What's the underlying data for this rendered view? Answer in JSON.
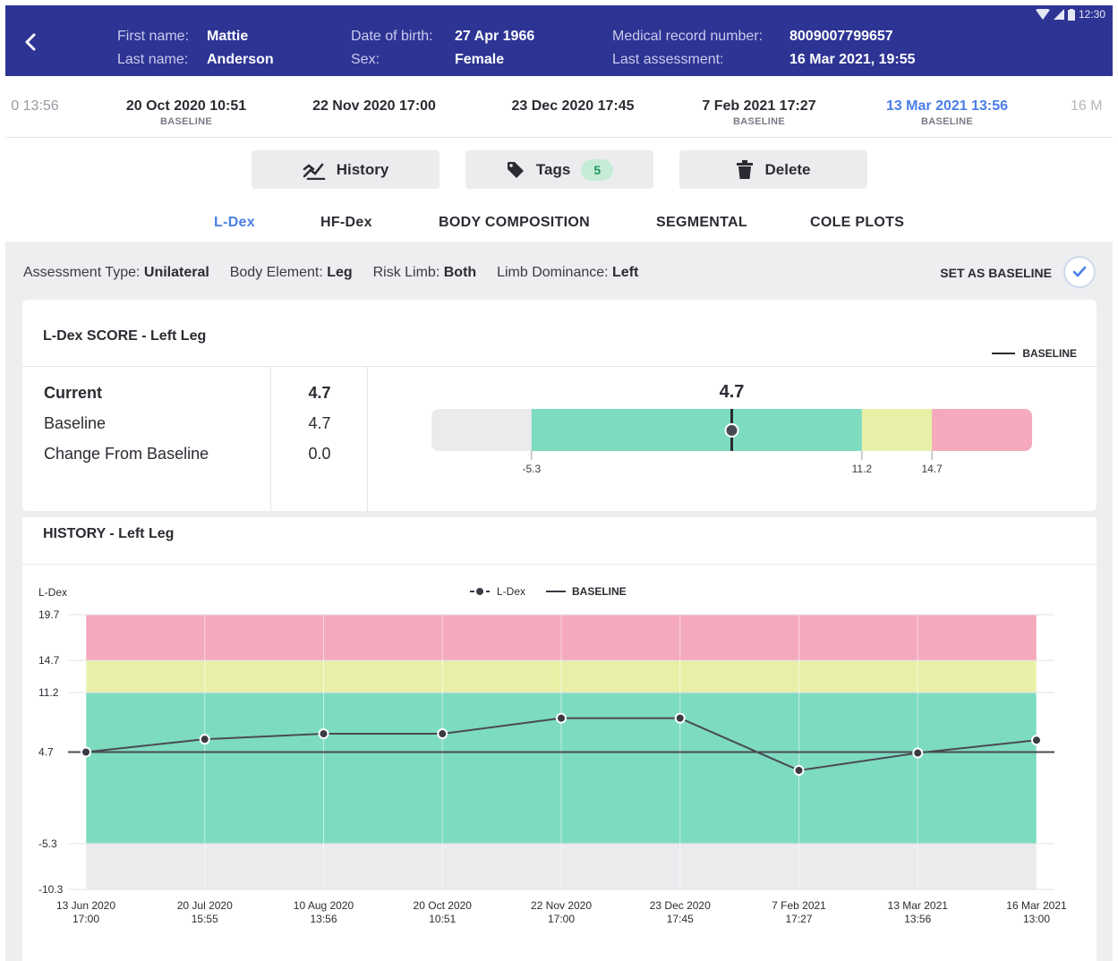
{
  "status_bar": {
    "time": "12:30"
  },
  "patient": {
    "first_name_label": "First name:",
    "first_name": "Mattie",
    "last_name_label": "Last name:",
    "last_name": "Anderson",
    "dob_label": "Date of birth:",
    "dob": "27 Apr 1966",
    "sex_label": "Sex:",
    "sex": "Female",
    "mrn_label": "Medical record number:",
    "mrn": "8009007799657",
    "last_assessment_label": "Last assessment:",
    "last_assessment": "16 Mar 2021, 19:55"
  },
  "timeline": {
    "items": [
      {
        "date": "0 13:56",
        "sub": ""
      },
      {
        "date": "20 Oct 2020 10:51",
        "sub": "BASELINE"
      },
      {
        "date": "22 Nov 2020 17:00",
        "sub": ""
      },
      {
        "date": "23 Dec 2020 17:45",
        "sub": ""
      },
      {
        "date": "7 Feb 2021 17:27",
        "sub": "BASELINE"
      },
      {
        "date": "13 Mar 2021 13:56",
        "sub": "BASELINE"
      },
      {
        "date": "16 M",
        "sub": ""
      }
    ]
  },
  "actions": {
    "history_label": "History",
    "tags_label": "Tags",
    "tags_count": "5",
    "delete_label": "Delete"
  },
  "tabs": {
    "ldex": "L-Dex",
    "hfdex": "HF-Dex",
    "body_comp": "BODY COMPOSITION",
    "segmental": "SEGMENTAL",
    "cole": "COLE PLOTS"
  },
  "assessment": {
    "type_label": "Assessment Type:",
    "type": "Unilateral",
    "element_label": "Body Element:",
    "element": "Leg",
    "risk_label": "Risk Limb:",
    "risk": "Both",
    "dominance_label": "Limb Dominance:",
    "dominance": "Left",
    "set_baseline": "SET AS BASELINE"
  },
  "score": {
    "title": "L-Dex SCORE - Left Leg",
    "legend_baseline": "BASELINE",
    "current_label": "Current",
    "current_value": "4.7",
    "baseline_label": "Baseline",
    "baseline_value": "4.7",
    "change_label": "Change From Baseline",
    "change_value": "0.0",
    "gauge_value_text": "4.7",
    "gauge_value": 4.7,
    "gauge_min": -10.3,
    "gauge_max": 19.7,
    "gauge_ticks": [
      "-5.3",
      "11.2",
      "14.7"
    ]
  },
  "history": {
    "title": "HISTORY - Left Leg"
  },
  "colors": {
    "header": "#2d3494",
    "accent": "#4a7ee8",
    "green_zone": "#7ddbc0",
    "yellow_zone": "#e8f0a8",
    "red_zone": "#f5a9bc",
    "gray_zone": "#ebebee"
  },
  "chart_data": {
    "type": "line",
    "ylabel": "L-Dex",
    "legend": [
      "L-Dex",
      "BASELINE"
    ],
    "legend_position": "top-center",
    "ylim": [
      -10.3,
      19.7
    ],
    "yticks": [
      "19.7",
      "14.7",
      "11.2",
      "4.7",
      "-5.3",
      "-10.3"
    ],
    "ytick_values": [
      19.7,
      14.7,
      11.2,
      4.7,
      -5.3,
      -10.3
    ],
    "categories": [
      [
        "13 Jun 2020",
        "17:00"
      ],
      [
        "20 Jul 2020",
        "15:55"
      ],
      [
        "10 Aug 2020",
        "13:56"
      ],
      [
        "20 Oct 2020",
        "10:51"
      ],
      [
        "22 Nov 2020",
        "17:00"
      ],
      [
        "23 Dec 2020",
        "17:45"
      ],
      [
        "7 Feb 2021",
        "17:27"
      ],
      [
        "13 Mar 2021",
        "13:56"
      ],
      [
        "16 Mar 2021",
        "13:00"
      ]
    ],
    "series": [
      {
        "name": "L-Dex",
        "values": [
          4.7,
          6.1,
          6.7,
          6.7,
          8.4,
          8.4,
          2.7,
          4.6,
          6.0
        ]
      },
      {
        "name": "BASELINE",
        "values": [
          4.7,
          4.7,
          4.7,
          4.7,
          4.7,
          4.7,
          4.7,
          4.7,
          4.7
        ]
      }
    ],
    "zones": [
      {
        "from": -10.3,
        "to": -5.3,
        "color": "gray"
      },
      {
        "from": -5.3,
        "to": 11.2,
        "color": "green"
      },
      {
        "from": 11.2,
        "to": 14.7,
        "color": "yellow"
      },
      {
        "from": 14.7,
        "to": 19.7,
        "color": "red"
      }
    ],
    "grid": true
  }
}
